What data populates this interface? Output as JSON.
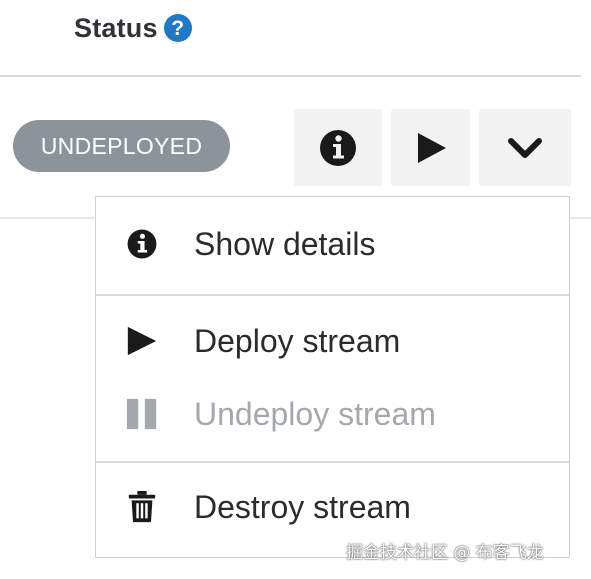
{
  "header": {
    "title": "Status",
    "help_icon": "question-circle-icon",
    "help_glyph": "?",
    "help_color": "#1f78c8"
  },
  "stream": {
    "status_badge": "UNDEPLOYED",
    "badge_color": "#8e9399"
  },
  "actions": {
    "info_icon": "info-circle-icon",
    "play_icon": "play-icon",
    "more_icon": "chevron-down-icon"
  },
  "menu": {
    "items": [
      {
        "label": "Show details",
        "icon": "info-circle-icon",
        "enabled": true
      },
      {
        "label": "Deploy stream",
        "icon": "play-icon",
        "enabled": true
      },
      {
        "label": "Undeploy stream",
        "icon": "pause-icon",
        "enabled": false
      },
      {
        "label": "Destroy stream",
        "icon": "trash-icon",
        "enabled": true
      }
    ]
  },
  "watermark": "掘金技术社区 @ 布客飞龙"
}
